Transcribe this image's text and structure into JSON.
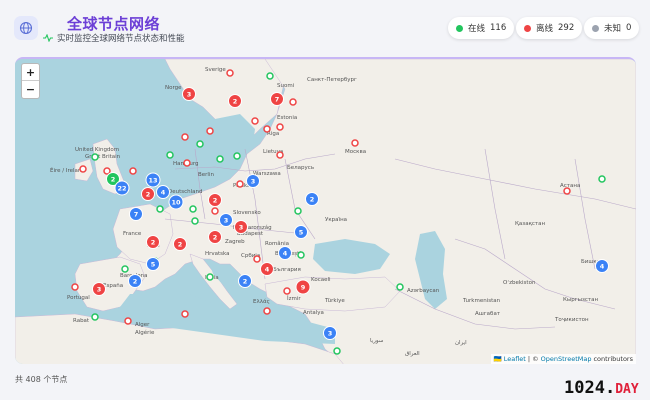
{
  "header": {
    "title": "全球节点网络",
    "subtitle": "实时监控全球网络节点状态和性能",
    "globe_icon": "globe-icon",
    "activity_icon": "activity-icon"
  },
  "stats": [
    {
      "label": "在线",
      "count": "116",
      "color": "#22c55e"
    },
    {
      "label": "离线",
      "count": "292",
      "color": "#ef4444"
    },
    {
      "label": "未知",
      "count": "0",
      "color": "#9ca3af"
    }
  ],
  "map": {
    "zoom_in": "+",
    "zoom_out": "−",
    "attribution": {
      "flag": "🇺🇦",
      "leaflet": "Leaflet",
      "sep": "| ©",
      "osm": "OpenStreetMap",
      "contrib": "contributors"
    },
    "labels": [
      "Sverige",
      "Санкт-Петербург",
      "Москва",
      "United Kingdom",
      "Great Britain",
      "Éire / Ireland",
      "Hamburg",
      "Berlin",
      "Deutschland",
      "Polska",
      "Lietuva",
      "Беларусь",
      "Україна",
      "Slovensko",
      "France",
      "Magyarország",
      "Zagreb",
      "Hrvatska",
      "România",
      "București",
      "Србија",
      "България",
      "Italia",
      "Barcelona",
      "España",
      "Portugal",
      "Algérie",
      "Rabat",
      "Alger",
      "Ελλάς",
      "İzmir",
      "Türkiye",
      "Antalya",
      "Azərbaycan",
      "Қазақстан",
      "Астана",
      "Oʻzbekiston",
      "Turkmenistan",
      "Кыргызстан",
      "Бишкек",
      "Ашгабат",
      "Тоҷикистон",
      "ایران",
      "العراق",
      "سوريا",
      "Kocaeli",
      "Lyon",
      "Budapest",
      "Warszawa",
      "Riga",
      "Estonia",
      "Norge",
      "Suomi"
    ],
    "clusters": [
      {
        "count": "3",
        "color": "#ef4444"
      },
      {
        "count": "2",
        "color": "#ef4444"
      },
      {
        "count": "7",
        "color": "#ef4444"
      },
      {
        "count": "2",
        "color": "#22c55e"
      },
      {
        "count": "22",
        "color": "#3b82f6"
      },
      {
        "count": "13",
        "color": "#3b82f6"
      },
      {
        "count": "2",
        "color": "#ef4444"
      },
      {
        "count": "4",
        "color": "#3b82f6"
      },
      {
        "count": "10",
        "color": "#3b82f6"
      },
      {
        "count": "7",
        "color": "#3b82f6"
      },
      {
        "count": "2",
        "color": "#ef4444"
      },
      {
        "count": "3",
        "color": "#3b82f6"
      },
      {
        "count": "2",
        "color": "#3b82f6"
      },
      {
        "count": "5",
        "color": "#3b82f6"
      },
      {
        "count": "3",
        "color": "#ef4444"
      },
      {
        "count": "3",
        "color": "#ef4444"
      },
      {
        "count": "2",
        "color": "#ef4444"
      },
      {
        "count": "2",
        "color": "#ef4444"
      },
      {
        "count": "2",
        "color": "#ef4444"
      },
      {
        "count": "4",
        "color": "#3b82f6"
      },
      {
        "count": "4",
        "color": "#ef4444"
      },
      {
        "count": "2",
        "color": "#3b82f6"
      },
      {
        "count": "5",
        "color": "#3b82f6"
      },
      {
        "count": "2",
        "color": "#3b82f6"
      },
      {
        "count": "3",
        "color": "#ef4444"
      },
      {
        "count": "9",
        "color": "#ef4444"
      },
      {
        "count": "3",
        "color": "#3b82f6"
      },
      {
        "count": "4",
        "color": "#3b82f6"
      }
    ]
  },
  "footer": {
    "total": "共 408 个节点"
  },
  "brand": {
    "main": "1024.",
    "accent": "DAY"
  }
}
